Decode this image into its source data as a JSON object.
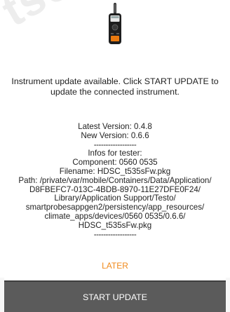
{
  "watermark": "tsc",
  "device_icon": "handheld-hygrometer-icon",
  "message": "Instrument update available. Click START UPDATE to update the connected instrument.",
  "versions": {
    "latest": "Latest Version: 0.4.8",
    "new": "New Version: 0.6.6",
    "separator": "------------------"
  },
  "tester": {
    "heading": "Infos for tester:",
    "component": "Component: 0560 0535",
    "filename": "Filename: HDSC_t535sFw.pkg",
    "path_lines": [
      "Path: /private/var/mobile/Containers/Data/Application/",
      "D8FBEFC7-013C-4BDB-8970-11E27DFE0F24/",
      "Library/Application Support/Testo/",
      "smartprobesappgen2/persistency/app_resources/",
      "climate_apps/devices/0560 0535/0.6.6/",
      "HDSC_t535sFw.pkg"
    ],
    "separator": "------------------"
  },
  "actions": {
    "later_label": "LATER",
    "start_label": "START UPDATE"
  },
  "colors": {
    "accent_orange": "#f08a1c",
    "button_bg": "#5b5b5b",
    "text": "#222222"
  }
}
